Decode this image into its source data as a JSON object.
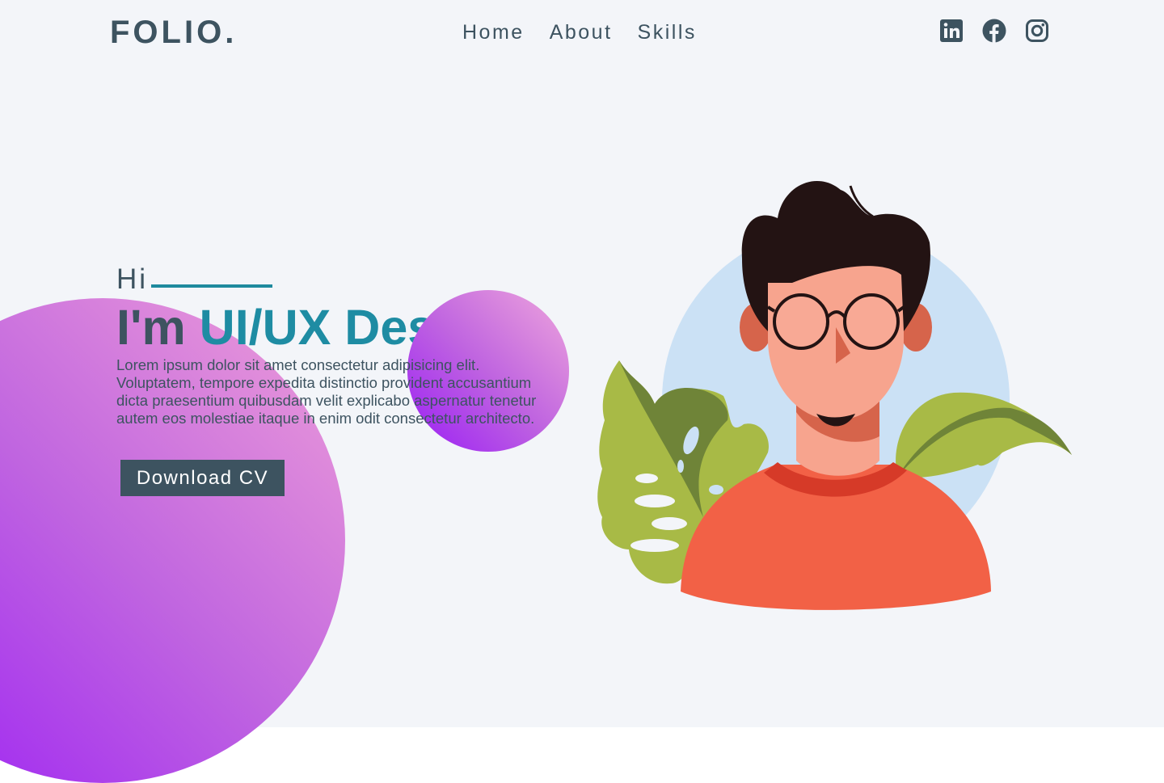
{
  "brand": {
    "logo": "FOLIO."
  },
  "nav": {
    "items": [
      "Home",
      "About",
      "Skills"
    ]
  },
  "social": {
    "icons": [
      "linkedin-icon",
      "facebook-icon",
      "instagram-icon"
    ]
  },
  "hero": {
    "greeting": "Hi",
    "headline_prefix": "I'm ",
    "headline_role": "UI/UX Des",
    "cursor": "|",
    "description": "Lorem ipsum dolor sit amet consectetur adipisicing elit. Voluptatem, tempore expedita distinctio provident accusantium dicta praesentium quibusdam velit explicabo aspernatur tenetur autem eos molestiae itaque in enim odit consectetur architecto.",
    "cta_label": "Download CV"
  },
  "colors": {
    "primary": "#3d5360",
    "accent": "#1e8ca3",
    "background": "#f3f5f9",
    "gradient_start": "#9a1df5",
    "gradient_end": "#ef9fd8"
  }
}
